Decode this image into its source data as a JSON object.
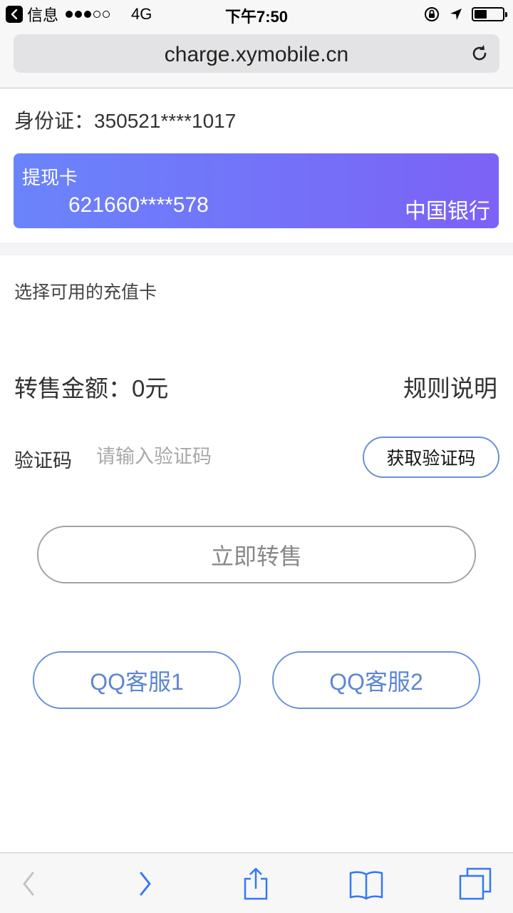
{
  "status_bar": {
    "back_app": "信息",
    "network": "4G",
    "time": "下午7:50"
  },
  "browser": {
    "url": "charge.xymobile.cn"
  },
  "account": {
    "id_label": "身份证：",
    "id_number": "350521****1017"
  },
  "card": {
    "title": "提现卡",
    "number": "621660****578",
    "bank": "中国银行"
  },
  "select_card_label": "选择可用的充值卡",
  "amount": {
    "label": "转售金额：",
    "value": "0元",
    "rules_link": "规则说明"
  },
  "verification": {
    "label": "验证码",
    "placeholder": "请输入验证码",
    "value": "",
    "get_code_button": "获取验证码"
  },
  "sell_button": "立即转售",
  "support": {
    "qq1": "QQ客服1",
    "qq2": "QQ客服2"
  },
  "colors": {
    "card_gradient_start": "#6a84fb",
    "card_gradient_end": "#7c62f6",
    "accent_blue": "#5d86d3",
    "toolbar_blue": "#3478f6"
  },
  "icons": [
    "back-app-icon",
    "orientation-lock-icon",
    "location-arrow-icon",
    "battery-icon",
    "reload-icon",
    "back-nav-icon",
    "forward-nav-icon",
    "share-icon",
    "bookmarks-icon",
    "tabs-icon"
  ]
}
